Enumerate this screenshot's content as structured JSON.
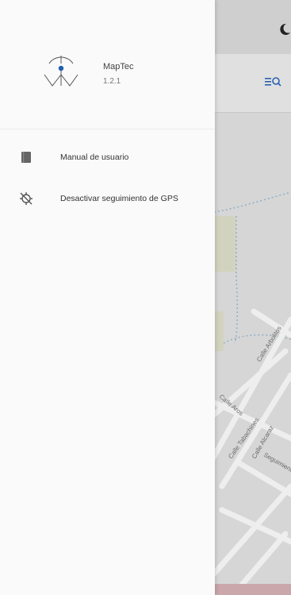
{
  "app": {
    "name": "MapTec",
    "version": "1.2.1",
    "accent_color": "#1f5fb0"
  },
  "drawer": {
    "items": [
      {
        "label": "Manual de usuario",
        "icon": "book-icon"
      },
      {
        "label": "Desactivar seguimiento de GPS",
        "icon": "gps-off-icon"
      }
    ]
  },
  "map": {
    "streets": [
      "Calle Arbolitos",
      "Calle Aros",
      "Calle Tabachines",
      "Calle Alcaraz",
      "Seguimiento"
    ]
  }
}
